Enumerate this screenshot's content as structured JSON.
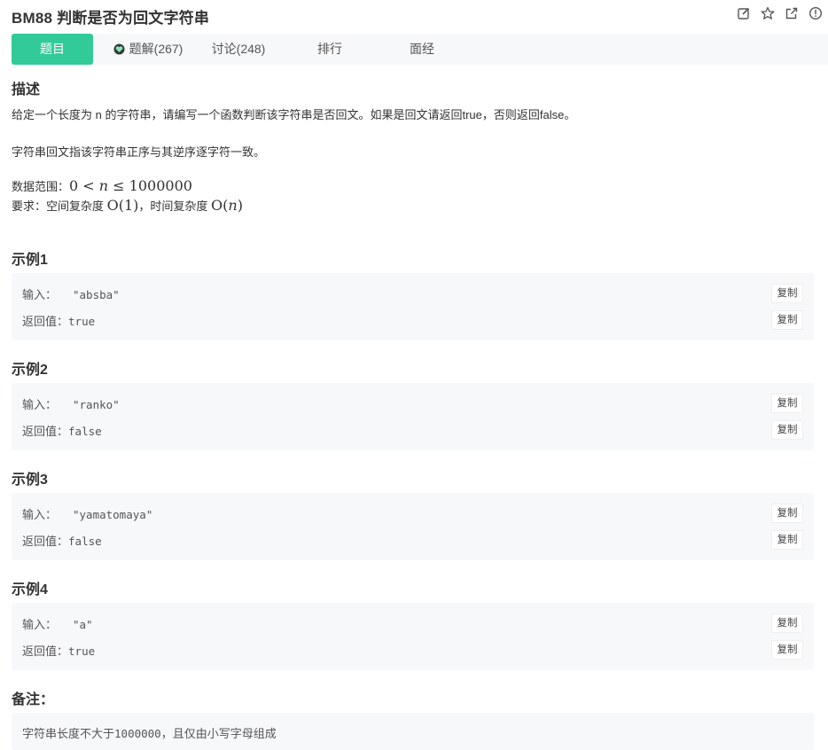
{
  "header": {
    "title": "BM88  判断是否为回文字符串",
    "icons": [
      "edit-icon",
      "star-icon",
      "share-icon",
      "info-icon"
    ]
  },
  "tabs": [
    {
      "label": "题目",
      "active": true
    },
    {
      "label": "题解(267)",
      "icon": "heart-badge-icon"
    },
    {
      "label": "讨论(248)"
    },
    {
      "label": "排行"
    },
    {
      "label": "面经"
    }
  ],
  "description": {
    "heading": "描述",
    "p1": "给定一个长度为 n 的字符串，请编写一个函数判断该字符串是否回文。如果是回文请返回true，否则返回false。",
    "p2": "字符串回文指该字符串正序与其逆序逐字符一致。",
    "range_label": "数据范围：",
    "range_lhs": "0 < ",
    "range_var": "n",
    "range_rhs": " ≤ 1000000",
    "req_label": "要求：空间复杂度 ",
    "req_space": "O(1)",
    "req_mid": "，时间复杂度 ",
    "req_time_o": "O(",
    "req_time_var": "n",
    "req_time_close": ")"
  },
  "examples": [
    {
      "heading": "示例1",
      "input_label": "输入：",
      "input": "\"absba\"",
      "output_label": "返回值：",
      "output": "true",
      "copy": "复制"
    },
    {
      "heading": "示例2",
      "input_label": "输入：",
      "input": "\"ranko\"",
      "output_label": "返回值：",
      "output": "false",
      "copy": "复制"
    },
    {
      "heading": "示例3",
      "input_label": "输入：",
      "input": "\"yamatomaya\"",
      "output_label": "返回值：",
      "output": "false",
      "copy": "复制"
    },
    {
      "heading": "示例4",
      "input_label": "输入：",
      "input": "\"a\"",
      "output_label": "返回值：",
      "output": "true",
      "copy": "复制"
    }
  ],
  "note": {
    "heading": "备注：",
    "text_a": "字符串长度不大于",
    "text_code": "1000000",
    "text_b": "，且仅由小写字母组成"
  },
  "colors": {
    "accent": "#32ca99",
    "panel": "#f7f8fa"
  }
}
